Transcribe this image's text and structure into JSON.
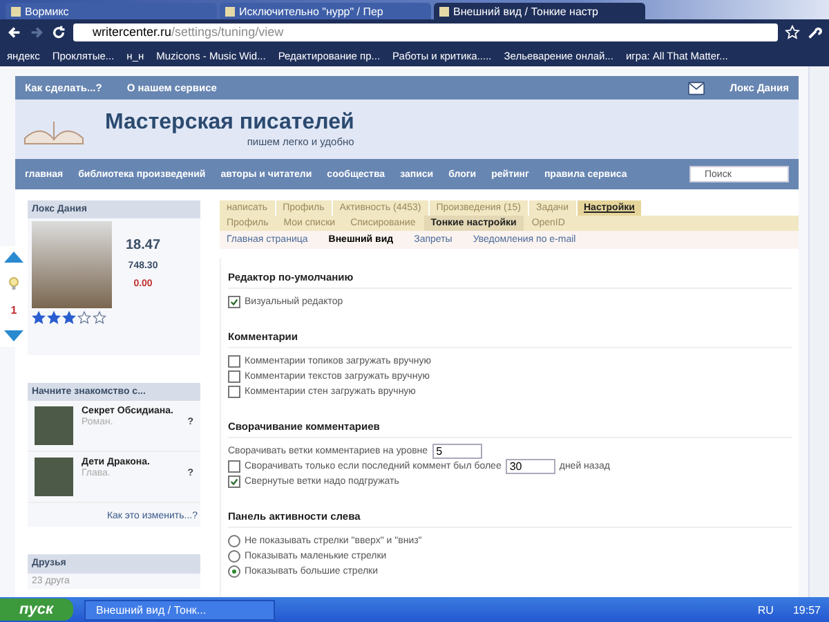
{
  "browser": {
    "tabs": [
      {
        "title": "Вормикс",
        "selected": false
      },
      {
        "title": "Исключительно \"нурр\" / Пер",
        "selected": false
      },
      {
        "title": "Внешний вид / Тонкие настр",
        "selected": true
      }
    ],
    "url_host": "writercenter.ru",
    "url_path": "/settings/tuning/view",
    "bookmarks": [
      "яндекс",
      "Проклятые...",
      "н_н",
      "Muzicons - Music Wid...",
      "Редактирование пр...",
      "Работы и критика.....",
      "Зельеварение онлай...",
      "игра: All That Matter..."
    ]
  },
  "site": {
    "top_links": [
      "Как сделать...?",
      "О нашем сервисе"
    ],
    "user": "Локс Дания",
    "title": "Мастерская писателей",
    "slogan": "пишем легко и удобно",
    "menu": [
      "главная",
      "библиотека произведений",
      "авторы и читатели",
      "сообщества",
      "записи",
      "блоги",
      "рейтинг",
      "правила сервиса"
    ],
    "search": {
      "placeholder": "Поиск"
    }
  },
  "vote_panel": {
    "count": "1"
  },
  "profile": {
    "name": "Локс Дания",
    "stats": [
      "18.47",
      "748.30",
      "0.00"
    ],
    "stars": 3
  },
  "recommend": {
    "title": "Начните знакомство с...",
    "items": [
      {
        "title": "Секрет Обсидиана.",
        "type": "Роман.",
        "mark": "?"
      },
      {
        "title": "Дети Дракона.",
        "type": "Глава.",
        "mark": "?"
      }
    ],
    "link": "Как это изменить...?"
  },
  "friends": {
    "title": "Друзья",
    "count": "23 друга"
  },
  "tabs": [
    {
      "label": "написать",
      "selected": false
    },
    {
      "label": "Профиль",
      "selected": false
    },
    {
      "label": "Активность (4453)",
      "selected": false
    },
    {
      "label": "Произведения (15)",
      "selected": false
    },
    {
      "label": "Задачи",
      "selected": false
    },
    {
      "label": "Настройки",
      "selected": true
    }
  ],
  "subtabs": [
    {
      "label": "Профиль",
      "selected": false
    },
    {
      "label": "Мои списки",
      "selected": false
    },
    {
      "label": "Списирование",
      "selected": false
    },
    {
      "label": "Тонкие настройки",
      "selected": true
    },
    {
      "label": "OpenID",
      "selected": false
    }
  ],
  "subsubtabs": [
    {
      "label": "Главная страница",
      "selected": false
    },
    {
      "label": "Внешний вид",
      "selected": true
    },
    {
      "label": "Запреты",
      "selected": false
    },
    {
      "label": "Уведомления по e-mail",
      "selected": false
    }
  ],
  "sections": [
    {
      "title": "Редактор по-умолчанию",
      "items": [
        {
          "kind": "checkbox",
          "label": "Визуальный редактор",
          "checked": true
        }
      ]
    },
    {
      "title": "Комментарии",
      "items": [
        {
          "kind": "checkbox",
          "label": "Комментарии топиков загружать вручную",
          "checked": false
        },
        {
          "kind": "checkbox",
          "label": "Комментарии текстов загружать вручную",
          "checked": false
        },
        {
          "kind": "checkbox",
          "label": "Комментарии стен загружать вручную",
          "checked": false
        }
      ]
    },
    {
      "title": "Сворачивание комментариев",
      "items": [
        {
          "kind": "number",
          "label": "Сворачивать ветки комментариев на уровне",
          "value": "5"
        },
        {
          "kind": "checkbox-number",
          "label": "Сворачивать только если последний коммент был более",
          "value": "30",
          "after": "дней назад",
          "checked": false
        },
        {
          "kind": "checkbox",
          "label": "Свернутые ветки надо подгружать",
          "checked": true
        }
      ]
    },
    {
      "title": "Панель активности слева",
      "items": [
        {
          "kind": "radio",
          "label": "Не показывать стрелки \"вверх\" и \"вниз\"",
          "selected": false
        },
        {
          "kind": "radio",
          "label": "Показывать маленькие стрелки",
          "selected": false
        },
        {
          "kind": "radio",
          "label": "Показывать большие стрелки",
          "selected": true
        }
      ]
    }
  ],
  "taskbar": {
    "start": "пуск",
    "task": "Внешний вид / Тонк...",
    "lang": "RU",
    "time": "19:57"
  }
}
